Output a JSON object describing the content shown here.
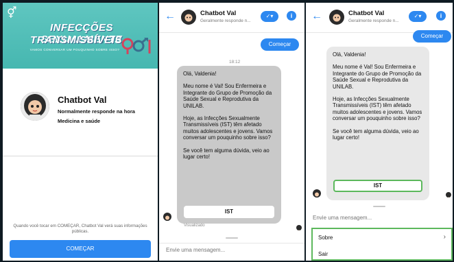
{
  "panel1": {
    "banner": {
      "title_line1": "INFECÇÕES SEXUALMENTE",
      "title_line2": "TRANSMISSÍVEIS",
      "subtitle": "VAMOS CONVERSAR UM POUQUINHO SOBRE ISSO?"
    },
    "profile": {
      "name": "Chatbot Val",
      "response_time": "Normalmente responde na hora",
      "category": "Medicina e saúde"
    },
    "notice": "Quando você tocar em COMEÇAR, Chatbot Val verá suas informações públicas.",
    "start_button": "COMEÇAR"
  },
  "chat_header": {
    "title": "Chatbot Val",
    "subtitle": "Geralmente responde n..."
  },
  "panel2": {
    "start_button": "Começar",
    "timestamp": "18:12",
    "message": [
      "Olá, Valdenia!",
      "Meu nome é Val! Sou Enfermeira e Integrante do Grupo de Promoção da Saúde Sexual e Reprodutiva da UNILAB.",
      "Hoje, as Infecções Sexualmente Transmissíveis (IST) têm afetado muitos adolescentes e jovens. Vamos conversar um pouquinho sobre isso?",
      "Se você tem alguma dúvida, veio ao lugar certo!"
    ],
    "quick_reply": "IST",
    "seen": "Visualizado",
    "composer_placeholder": "Envie uma mensagem..."
  },
  "panel3": {
    "start_button": "Começar",
    "message": [
      "Olá, Valdenia!",
      "Meu nome é Val! Sou Enfermeira e Integrante do Grupo de Promoção da Saúde Sexual e Reprodutiva da UNILAB.",
      "Hoje, as Infecções Sexualmente Transmissíveis (IST) têm afetado muitos adolescentes e jovens. Vamos conversar um pouquinho sobre isso?",
      "Se você tem alguma dúvida, veio ao lugar certo!"
    ],
    "quick_reply": "IST",
    "composer_placeholder": "Envie uma mensagem...",
    "menu": {
      "about": "Sobre",
      "exit": "Sair"
    }
  },
  "colors": {
    "accent": "#2d88f0",
    "banner": "#46b7b0",
    "bubble": "#c9c9c9",
    "highlight": "#5cb85c"
  }
}
